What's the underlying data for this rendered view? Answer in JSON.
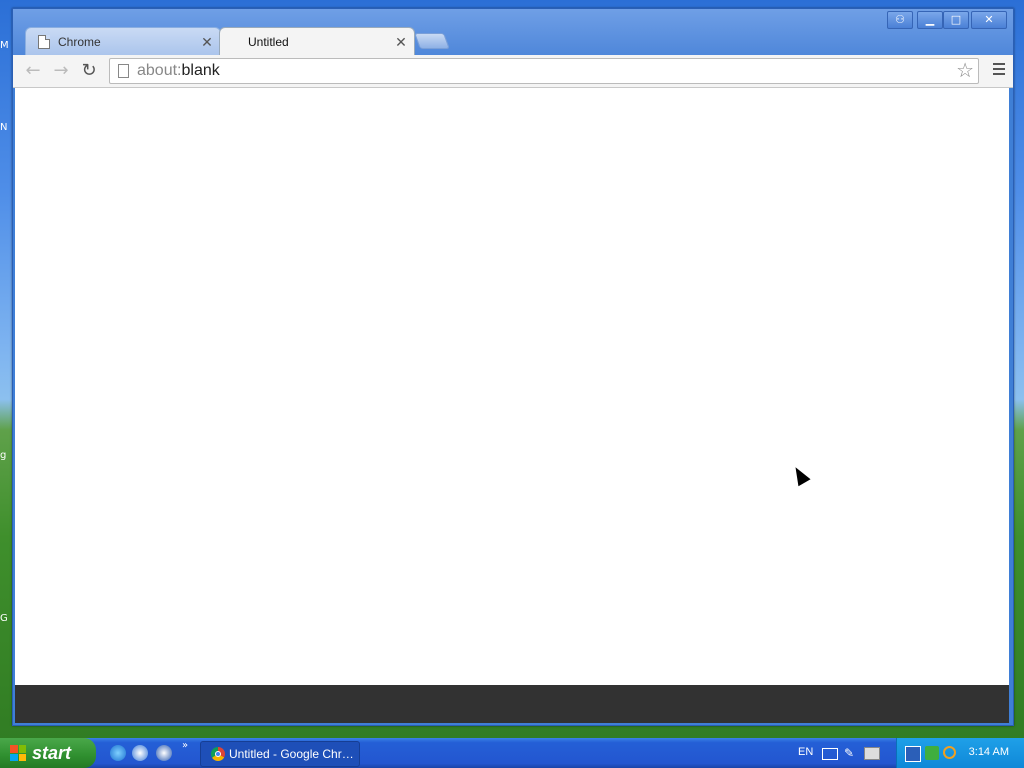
{
  "browser": {
    "tabs": [
      {
        "label": "Chrome",
        "active": false
      },
      {
        "label": "Untitled",
        "active": true
      }
    ],
    "omnibox": {
      "scheme": "about:",
      "host": "blank"
    }
  },
  "taskbar": {
    "start_label": "start",
    "task_item_label": "Untitled - Google Chr…",
    "language": "EN",
    "clock": "3:14 AM"
  },
  "icons": {
    "back": "arrow-left-icon",
    "forward": "arrow-right-icon",
    "reload": "reload-icon",
    "star": "star-icon",
    "menu": "hamburger-icon"
  },
  "colors": {
    "titlebar": "#4f87da",
    "taskbar": "#245fd6",
    "start": "#2f8f2f",
    "content_bg": "#ffffff",
    "bottom_bar": "#323232"
  }
}
